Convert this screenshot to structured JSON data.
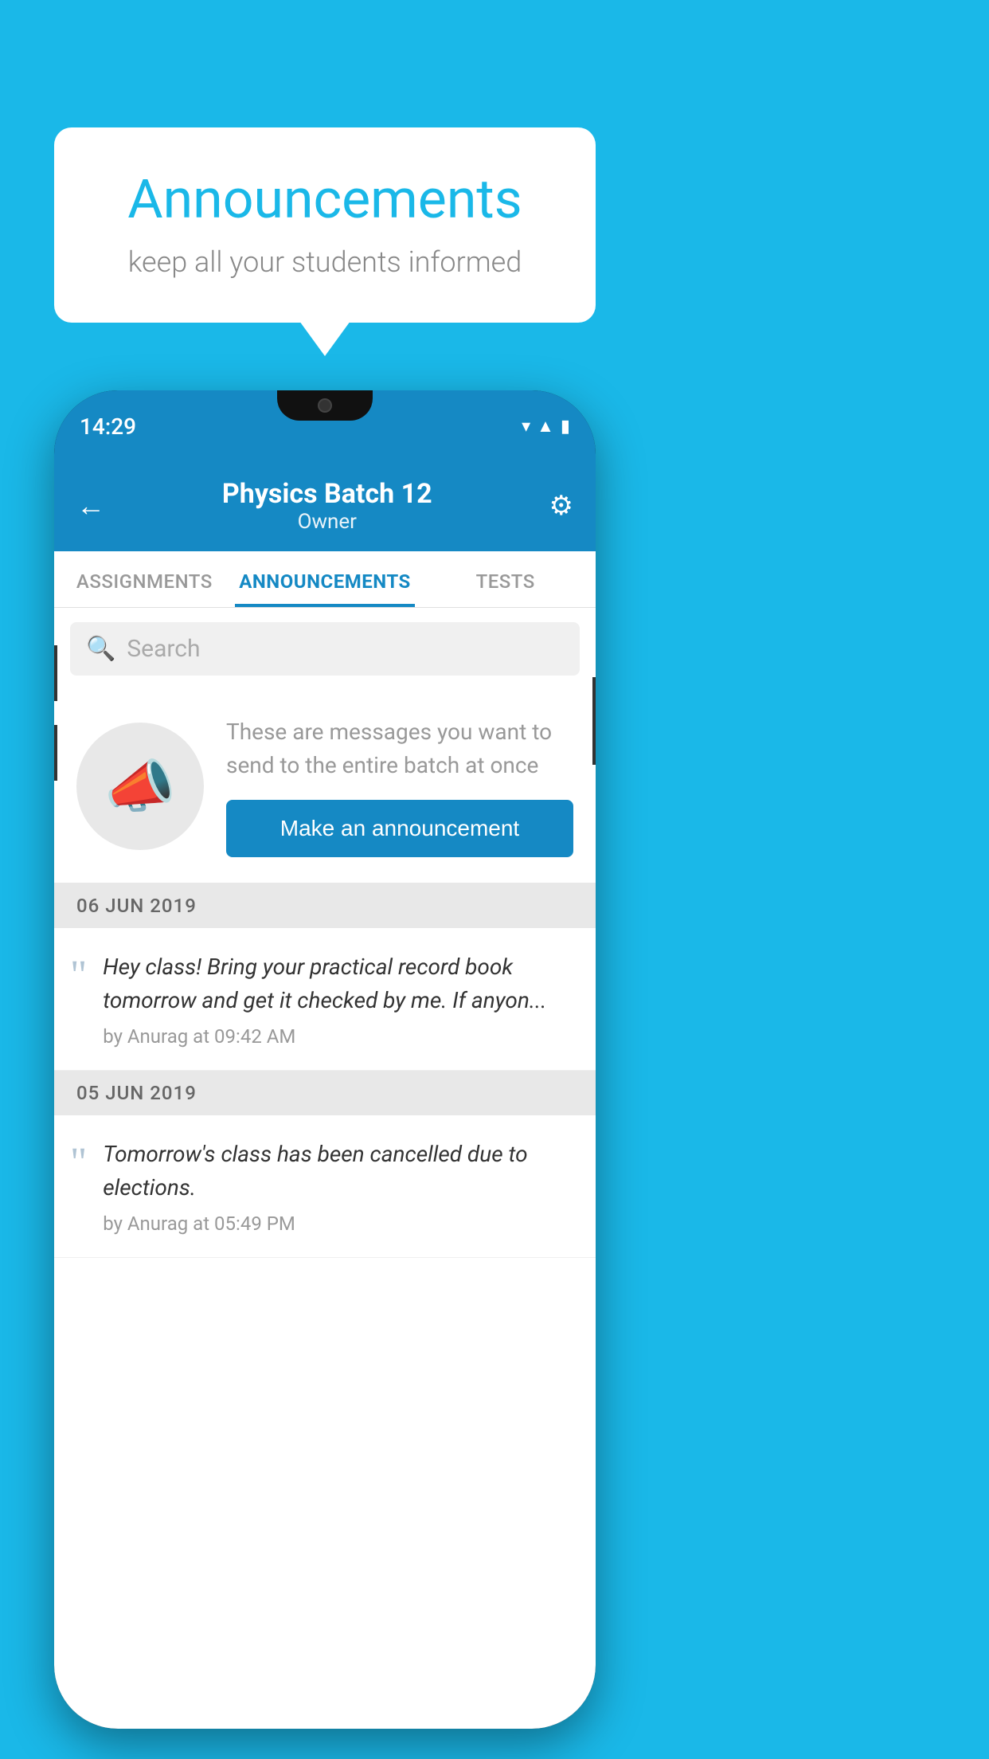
{
  "background_color": "#1ab8e8",
  "speech_bubble": {
    "title": "Announcements",
    "subtitle": "keep all your students informed"
  },
  "phone": {
    "status_bar": {
      "time": "14:29"
    },
    "header": {
      "back_label": "←",
      "batch_name": "Physics Batch 12",
      "role": "Owner",
      "settings_label": "⚙"
    },
    "tabs": [
      {
        "label": "ASSIGNMENTS",
        "active": false
      },
      {
        "label": "ANNOUNCEMENTS",
        "active": true
      },
      {
        "label": "TESTS",
        "active": false
      }
    ],
    "search": {
      "placeholder": "Search"
    },
    "promo": {
      "description": "These are messages you want to send to the entire batch at once",
      "button_label": "Make an announcement"
    },
    "announcements": [
      {
        "date": "06  JUN  2019",
        "text": "Hey class! Bring your practical record book tomorrow and get it checked by me. If anyon...",
        "meta": "by Anurag at 09:42 AM"
      },
      {
        "date": "05  JUN  2019",
        "text": "Tomorrow's class has been cancelled due to elections.",
        "meta": "by Anurag at 05:49 PM"
      }
    ]
  }
}
